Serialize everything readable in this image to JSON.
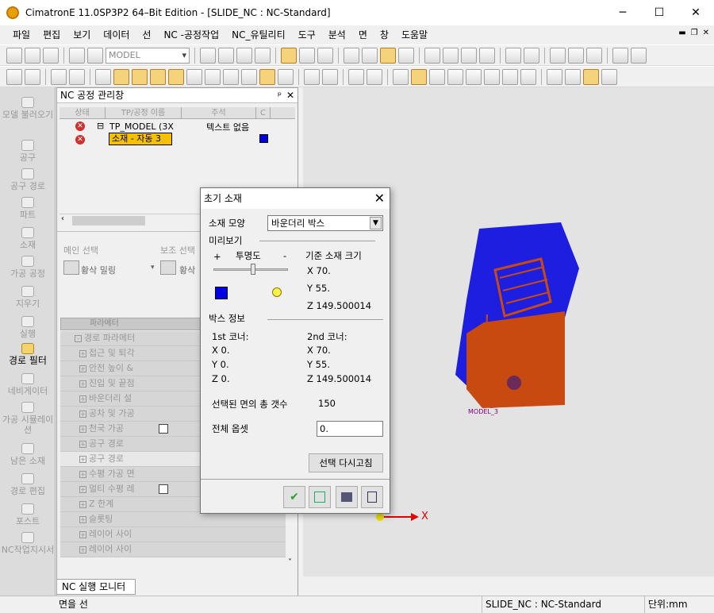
{
  "window": {
    "title": "CimatronE 11.0SP3P2 64–Bit Edition - [SLIDE_NC : NC-Standard]",
    "min_icon": "─",
    "max_icon": "☐",
    "close_icon": "✕"
  },
  "menu": [
    "파일",
    "편집",
    "보기",
    "데이터",
    "선",
    "NC -공정작업",
    "NC_유틸리티",
    "도구",
    "분석",
    "면",
    "창",
    "도움말"
  ],
  "toolbar": {
    "model_combo": "MODEL"
  },
  "left_tabs": [
    "모델 불러오기",
    "공구",
    "공구 경로",
    "파트",
    "소재",
    "가공 공정",
    "지우기",
    "실행",
    "경로 필터",
    "네비게이터",
    "가공 시뮬레이션",
    "남은 소재",
    "경로 편집",
    "포스트",
    "NC작업지시서"
  ],
  "nc_panel": {
    "title": "NC 공정 관리창",
    "pin": "ᵖ",
    "close": "✕",
    "columns": {
      "status": "상태",
      "tp_name": "TP/공정 이름",
      "comment": "주석",
      "c": "C"
    },
    "tree": {
      "root_label": "TP_MODEL (3X",
      "root_comment": "텍스트 없음",
      "child_label": "소재 - 자동 3"
    },
    "main_select_label": "메인 선택",
    "sub_select_label": "보조 선택",
    "main_select_value": "황삭 밀링",
    "sub_select_value": "황삭",
    "param_header": "파라메터",
    "param_root": "경로 파라메터",
    "params": [
      "접근 및 퇴각",
      "안전 높이 &",
      "진입 및 끝점",
      "바운더리 설",
      "공차 및 가공",
      "천국 가공",
      "공구 경로",
      "공구 경로",
      "수평 가공 면",
      "멀티 수평 레",
      "Z 한계",
      "슬롯팅",
      "레이어 사이",
      "레이어 사이"
    ]
  },
  "dialog": {
    "title": "초기 소재",
    "close": "✕",
    "shape_label": "소재 모양",
    "shape_value": "바운더리 박스",
    "preview_label": "미리보기",
    "plus": "+",
    "transparency": "투명도",
    "minus": "-",
    "stock_size_label": "기준 소재 크기",
    "size_x": "X 70.",
    "size_y": "Y 55.",
    "size_z": "Z 149.500014",
    "box_info_label": "박스 정보",
    "corner1_label": "1st 코너:",
    "corner2_label": "2nd 코너:",
    "c1_x": "X 0.",
    "c1_y": "Y 0.",
    "c1_z": "Z 0.",
    "c2_x": "X 70.",
    "c2_y": "Y 55.",
    "c2_z": "Z 149.500014",
    "faces_label": "선택된 면의 총 갯수",
    "faces_value": "150",
    "offset_label": "전체 옵셋",
    "offset_value": "0.",
    "reselect_button": "선택 다시고침",
    "ok_icon": "✔"
  },
  "viewport": {
    "model_label": "MODEL_3",
    "axis_label": "X"
  },
  "bottom_tab": "NC 실행 모니터",
  "status": {
    "left": "면을 선",
    "doc": "SLIDE_NC : NC-Standard",
    "units": "단위:mm"
  }
}
